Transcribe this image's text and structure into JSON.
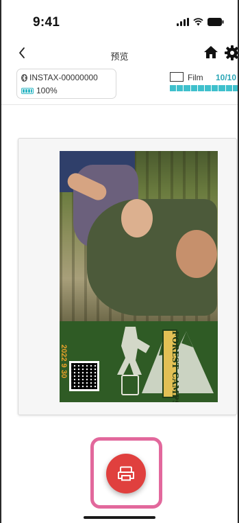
{
  "status_bar": {
    "time": "9:41"
  },
  "nav": {
    "title": "预览",
    "back_icon": "chevron-left-icon",
    "home_icon": "home-icon",
    "settings_icon": "gear-icon"
  },
  "printer": {
    "name": "INSTAX-00000000",
    "battery": "100%"
  },
  "film": {
    "label": "Film",
    "count": "10/10",
    "remaining_fraction": 1.0
  },
  "photo": {
    "template_date": "2022 9 30",
    "template_badge": "FOREST CAMPSITE"
  },
  "actions": {
    "print_icon": "printer-icon"
  },
  "colors": {
    "accent": "#2fb6c4",
    "print_button": "#e0403e",
    "highlight": "#e2689c",
    "template_green": "#2f5b25"
  }
}
